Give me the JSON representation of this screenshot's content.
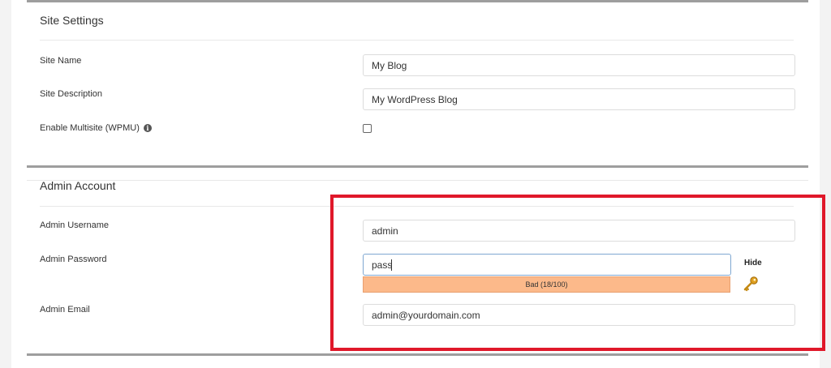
{
  "site_settings": {
    "title": "Site Settings",
    "site_name_label": "Site Name",
    "site_name_value": "My Blog",
    "site_description_label": "Site Description",
    "site_description_value": "My WordPress Blog",
    "multisite_label": "Enable Multisite (WPMU)",
    "multisite_info_glyph": "i",
    "multisite_checked": false
  },
  "admin_account": {
    "title": "Admin Account",
    "username_label": "Admin Username",
    "username_value": "admin",
    "password_label": "Admin Password",
    "password_value": "pass",
    "hide_label": "Hide",
    "strength_text": "Bad (18/100)",
    "strength_color": "#fcb98a",
    "email_label": "Admin Email",
    "email_value": "admin@yourdomain.com"
  },
  "colors": {
    "highlight": "#e0182a",
    "section_border": "#9e9e9e"
  }
}
